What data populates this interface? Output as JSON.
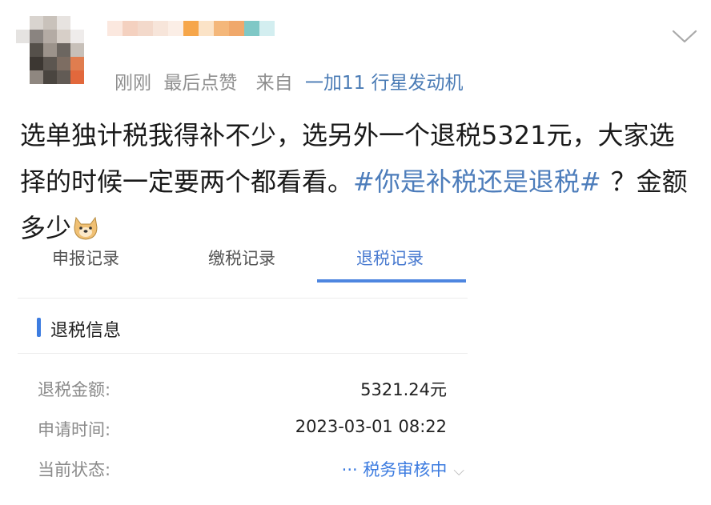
{
  "post": {
    "meta": {
      "time": "刚刚",
      "action": "最后点赞",
      "source_prefix": "来自",
      "device": "一加11 行星发动机"
    },
    "text_part1": "选单独计税我得补不少，选另外一个退税5321元，大家选择的时候一定要两个都看看。",
    "hashtag": "#你是补税还是退税#",
    "text_part2": "？金额多少"
  },
  "embedded": {
    "tabs": [
      {
        "label": "申报记录"
      },
      {
        "label": "缴税记录"
      },
      {
        "label": "退税记录"
      }
    ],
    "section_title": "退税信息",
    "rows": [
      {
        "label": "退税金额:",
        "value": "5321.24元"
      },
      {
        "label": "申请时间:",
        "value": "2023-03-01 08:22"
      },
      {
        "label": "当前状态:",
        "value": "··· 税务审核中"
      }
    ]
  },
  "colors": {
    "link_blue": "#4d7dbb",
    "accent_blue": "#3d7ce0",
    "meta_gray": "#8f8f8f"
  },
  "icons": {
    "chevron": "chevron-down-icon",
    "emoji": "doge-emoji-icon"
  }
}
